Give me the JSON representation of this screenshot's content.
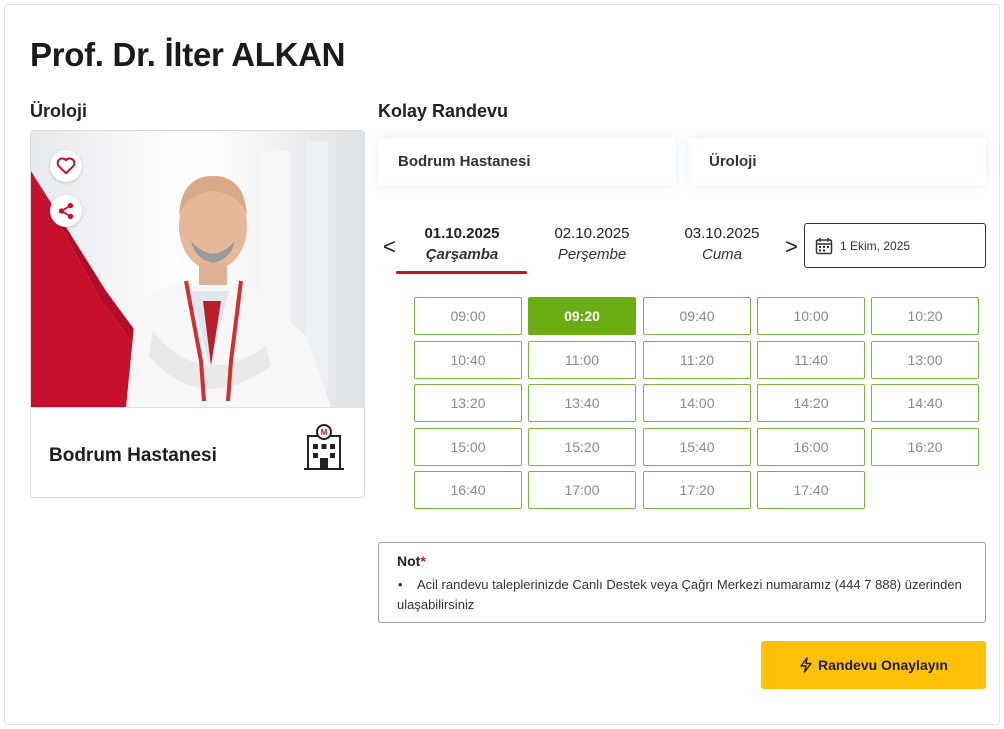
{
  "doctor": {
    "name": "Prof. Dr. İlter ALKAN",
    "department": "Üroloji",
    "hospital": "Bodrum Hastanesi"
  },
  "icons": {
    "favorite": "heart-icon",
    "share": "share-icon",
    "hospital": "hospital-building-icon",
    "calendar": "calendar-icon",
    "confirm": "lightning-icon"
  },
  "colors": {
    "accent_red": "#c8102e",
    "selected_slot": "#6aad12",
    "slot_border": "#7cb342",
    "confirm": "#ffc107"
  },
  "booking": {
    "title": "Kolay Randevu",
    "hospital_select": "Bodrum Hastanesi",
    "department_select": "Üroloji",
    "prev_arrow": "<",
    "next_arrow": ">",
    "dates": [
      {
        "date": "01.10.2025",
        "weekday": "Çarşamba",
        "active": true
      },
      {
        "date": "02.10.2025",
        "weekday": "Perşembe",
        "active": false
      },
      {
        "date": "03.10.2025",
        "weekday": "Cuma",
        "active": false
      }
    ],
    "date_picker_value": "1 Ekim, 2025",
    "slots": [
      "09:00",
      "09:20",
      "09:40",
      "10:00",
      "10:20",
      "10:40",
      "11:00",
      "11:20",
      "11:40",
      "13:00",
      "13:20",
      "13:40",
      "14:00",
      "14:20",
      "14:40",
      "15:00",
      "15:20",
      "15:40",
      "16:00",
      "16:20",
      "16:40",
      "17:00",
      "17:20",
      "17:40"
    ],
    "selected_slot": "09:20"
  },
  "note": {
    "title": "Not",
    "required_mark": "*",
    "bullet": "•",
    "text": "Acil randevu taleplerinizde Canlı Destek veya Çağrı Merkezi numaramız (444 7 888) üzerinden ulaşabilirsiniz"
  },
  "confirm_button": "Randevu Onaylayın"
}
